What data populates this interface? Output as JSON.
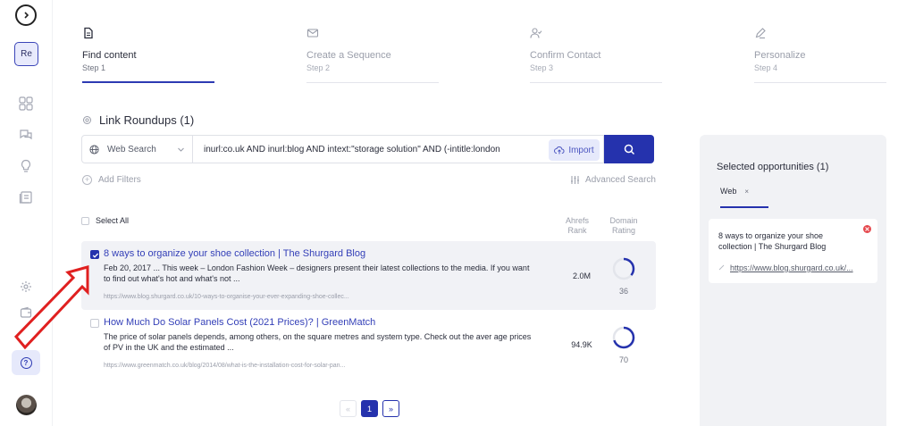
{
  "sidebar": {
    "toggle_label": "",
    "workspace_initials": "Re",
    "help_glyph": "?",
    "icons": [
      "chevron-right-icon",
      "grid-icon",
      "chat-icon",
      "lightbulb-icon",
      "list-icon",
      "gear-icon",
      "wallet-icon",
      "help-icon",
      "user-avatar"
    ]
  },
  "steps": [
    {
      "title": "Find content",
      "sub": "Step 1",
      "icon": "document-icon",
      "active": true
    },
    {
      "title": "Create a Sequence",
      "sub": "Step 2",
      "icon": "mail-icon",
      "active": false
    },
    {
      "title": "Confirm Contact",
      "sub": "Step 3",
      "icon": "user-check-icon",
      "active": false
    },
    {
      "title": "Personalize",
      "sub": "Step 4",
      "icon": "pen-icon",
      "active": false
    }
  ],
  "section": {
    "title": "Link Roundups (1)"
  },
  "search": {
    "source": "Web Search",
    "query": "inurl:co.uk AND inurl:blog AND intext:\"storage solution\" AND (-intitle:london",
    "import_label": "Import"
  },
  "filters": {
    "add_label": "Add Filters",
    "advanced_label": "Advanced Search"
  },
  "table": {
    "select_all": "Select All",
    "col_rank": [
      "Ahrefs",
      "Rank"
    ],
    "col_domain": [
      "Domain",
      "Rating"
    ]
  },
  "results": [
    {
      "title": "8 ways to organize your shoe collection | The Shurgard Blog",
      "desc": "Feb 20, 2017 ... This week – London Fashion Week – designers present their latest collections to the media. If you want to find out what's hot and what's not ...",
      "url": "https://www.blog.shurgard.co.uk/10-ways-to-organise-your-ever-expanding-shoe-collec...",
      "rank": "2.0M",
      "dr": "36",
      "dr_value": 36,
      "selected": true
    },
    {
      "title": "How Much Do Solar Panels Cost (2021 Prices)? | GreenMatch",
      "desc": "The price of solar panels depends, among others, on the square metres and system type. Check out the aver age prices of PV in the UK and the estimated ...",
      "url": "https://www.greenmatch.co.uk/blog/2014/08/what-is-the-installation-cost-for-solar-pan...",
      "rank": "94.9K",
      "dr": "70",
      "dr_value": 70,
      "selected": false
    }
  ],
  "pagination": {
    "prev": "«",
    "current": "1",
    "next": "»"
  },
  "panel": {
    "title": "Selected opportunities (1)",
    "tab": "Web",
    "tab_close": "×",
    "card_title": "8 ways to organize your shoe collection | The Shurgard Blog",
    "card_url": "https://www.blog.shurgard.co.uk/..."
  },
  "colors": {
    "accent": "#2532ad",
    "link": "#3440b8",
    "danger": "#e5484d",
    "annotation_arrow": "#e02020"
  }
}
